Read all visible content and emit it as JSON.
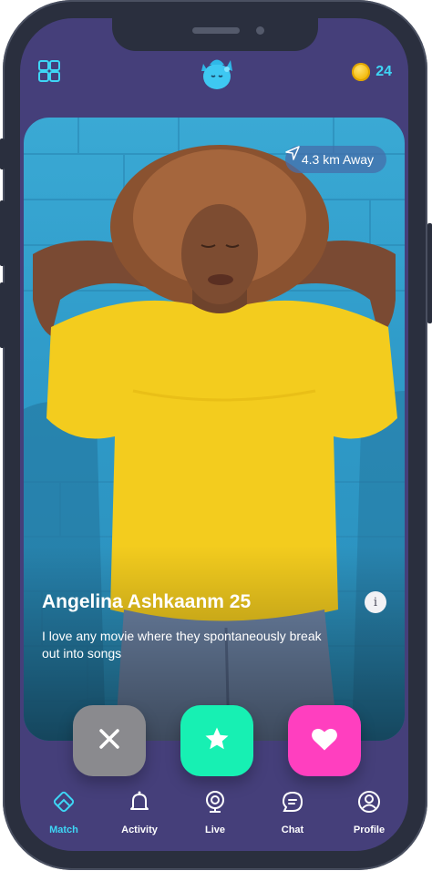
{
  "header": {
    "coin_count": "24",
    "menu_icon": "grid-icon",
    "logo_icon": "mascot-icon"
  },
  "card": {
    "distance": "4.3 km Away",
    "name": "Angelina Ashkaanm 25",
    "bio": "I love any movie where they spontaneously break out into songs",
    "info_label": "i"
  },
  "actions": {
    "nope_icon": "close-icon",
    "superlike_icon": "star-icon",
    "like_icon": "heart-icon"
  },
  "tabs": [
    {
      "label": "Match",
      "icon": "match-icon",
      "active": true
    },
    {
      "label": "Activity",
      "icon": "bell-icon",
      "active": false
    },
    {
      "label": "Live",
      "icon": "webcam-icon",
      "active": false
    },
    {
      "label": "Chat",
      "icon": "chat-icon",
      "active": false
    },
    {
      "label": "Profile",
      "icon": "user-icon",
      "active": false
    }
  ],
  "colors": {
    "screen_bg": "#453f7a",
    "accent": "#3ed6f5",
    "nope": "#8a8a8e",
    "superlike": "#17f0b3",
    "like": "#ff3fbf"
  }
}
